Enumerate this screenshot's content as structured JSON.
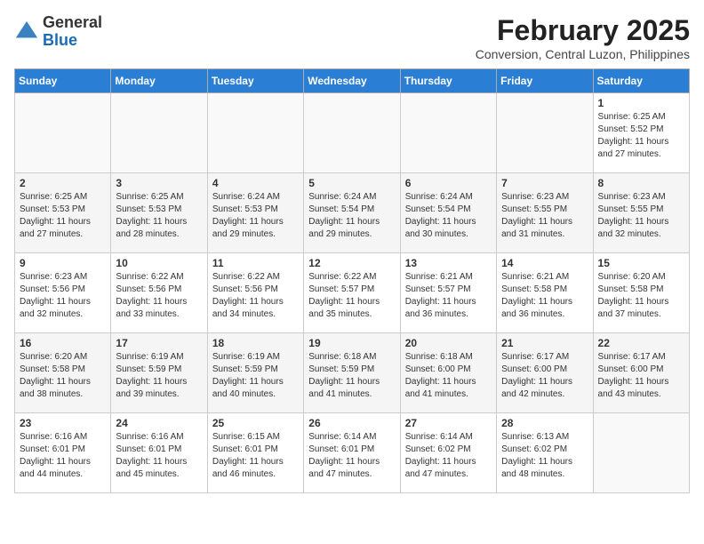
{
  "header": {
    "logo_general": "General",
    "logo_blue": "Blue",
    "month_year": "February 2025",
    "location": "Conversion, Central Luzon, Philippines"
  },
  "days_of_week": [
    "Sunday",
    "Monday",
    "Tuesday",
    "Wednesday",
    "Thursday",
    "Friday",
    "Saturday"
  ],
  "weeks": [
    [
      {
        "day": "",
        "info": ""
      },
      {
        "day": "",
        "info": ""
      },
      {
        "day": "",
        "info": ""
      },
      {
        "day": "",
        "info": ""
      },
      {
        "day": "",
        "info": ""
      },
      {
        "day": "",
        "info": ""
      },
      {
        "day": "1",
        "info": "Sunrise: 6:25 AM\nSunset: 5:52 PM\nDaylight: 11 hours and 27 minutes."
      }
    ],
    [
      {
        "day": "2",
        "info": "Sunrise: 6:25 AM\nSunset: 5:53 PM\nDaylight: 11 hours and 27 minutes."
      },
      {
        "day": "3",
        "info": "Sunrise: 6:25 AM\nSunset: 5:53 PM\nDaylight: 11 hours and 28 minutes."
      },
      {
        "day": "4",
        "info": "Sunrise: 6:24 AM\nSunset: 5:53 PM\nDaylight: 11 hours and 29 minutes."
      },
      {
        "day": "5",
        "info": "Sunrise: 6:24 AM\nSunset: 5:54 PM\nDaylight: 11 hours and 29 minutes."
      },
      {
        "day": "6",
        "info": "Sunrise: 6:24 AM\nSunset: 5:54 PM\nDaylight: 11 hours and 30 minutes."
      },
      {
        "day": "7",
        "info": "Sunrise: 6:23 AM\nSunset: 5:55 PM\nDaylight: 11 hours and 31 minutes."
      },
      {
        "day": "8",
        "info": "Sunrise: 6:23 AM\nSunset: 5:55 PM\nDaylight: 11 hours and 32 minutes."
      }
    ],
    [
      {
        "day": "9",
        "info": "Sunrise: 6:23 AM\nSunset: 5:56 PM\nDaylight: 11 hours and 32 minutes."
      },
      {
        "day": "10",
        "info": "Sunrise: 6:22 AM\nSunset: 5:56 PM\nDaylight: 11 hours and 33 minutes."
      },
      {
        "day": "11",
        "info": "Sunrise: 6:22 AM\nSunset: 5:56 PM\nDaylight: 11 hours and 34 minutes."
      },
      {
        "day": "12",
        "info": "Sunrise: 6:22 AM\nSunset: 5:57 PM\nDaylight: 11 hours and 35 minutes."
      },
      {
        "day": "13",
        "info": "Sunrise: 6:21 AM\nSunset: 5:57 PM\nDaylight: 11 hours and 36 minutes."
      },
      {
        "day": "14",
        "info": "Sunrise: 6:21 AM\nSunset: 5:58 PM\nDaylight: 11 hours and 36 minutes."
      },
      {
        "day": "15",
        "info": "Sunrise: 6:20 AM\nSunset: 5:58 PM\nDaylight: 11 hours and 37 minutes."
      }
    ],
    [
      {
        "day": "16",
        "info": "Sunrise: 6:20 AM\nSunset: 5:58 PM\nDaylight: 11 hours and 38 minutes."
      },
      {
        "day": "17",
        "info": "Sunrise: 6:19 AM\nSunset: 5:59 PM\nDaylight: 11 hours and 39 minutes."
      },
      {
        "day": "18",
        "info": "Sunrise: 6:19 AM\nSunset: 5:59 PM\nDaylight: 11 hours and 40 minutes."
      },
      {
        "day": "19",
        "info": "Sunrise: 6:18 AM\nSunset: 5:59 PM\nDaylight: 11 hours and 41 minutes."
      },
      {
        "day": "20",
        "info": "Sunrise: 6:18 AM\nSunset: 6:00 PM\nDaylight: 11 hours and 41 minutes."
      },
      {
        "day": "21",
        "info": "Sunrise: 6:17 AM\nSunset: 6:00 PM\nDaylight: 11 hours and 42 minutes."
      },
      {
        "day": "22",
        "info": "Sunrise: 6:17 AM\nSunset: 6:00 PM\nDaylight: 11 hours and 43 minutes."
      }
    ],
    [
      {
        "day": "23",
        "info": "Sunrise: 6:16 AM\nSunset: 6:01 PM\nDaylight: 11 hours and 44 minutes."
      },
      {
        "day": "24",
        "info": "Sunrise: 6:16 AM\nSunset: 6:01 PM\nDaylight: 11 hours and 45 minutes."
      },
      {
        "day": "25",
        "info": "Sunrise: 6:15 AM\nSunset: 6:01 PM\nDaylight: 11 hours and 46 minutes."
      },
      {
        "day": "26",
        "info": "Sunrise: 6:14 AM\nSunset: 6:01 PM\nDaylight: 11 hours and 47 minutes."
      },
      {
        "day": "27",
        "info": "Sunrise: 6:14 AM\nSunset: 6:02 PM\nDaylight: 11 hours and 47 minutes."
      },
      {
        "day": "28",
        "info": "Sunrise: 6:13 AM\nSunset: 6:02 PM\nDaylight: 11 hours and 48 minutes."
      },
      {
        "day": "",
        "info": ""
      }
    ]
  ]
}
